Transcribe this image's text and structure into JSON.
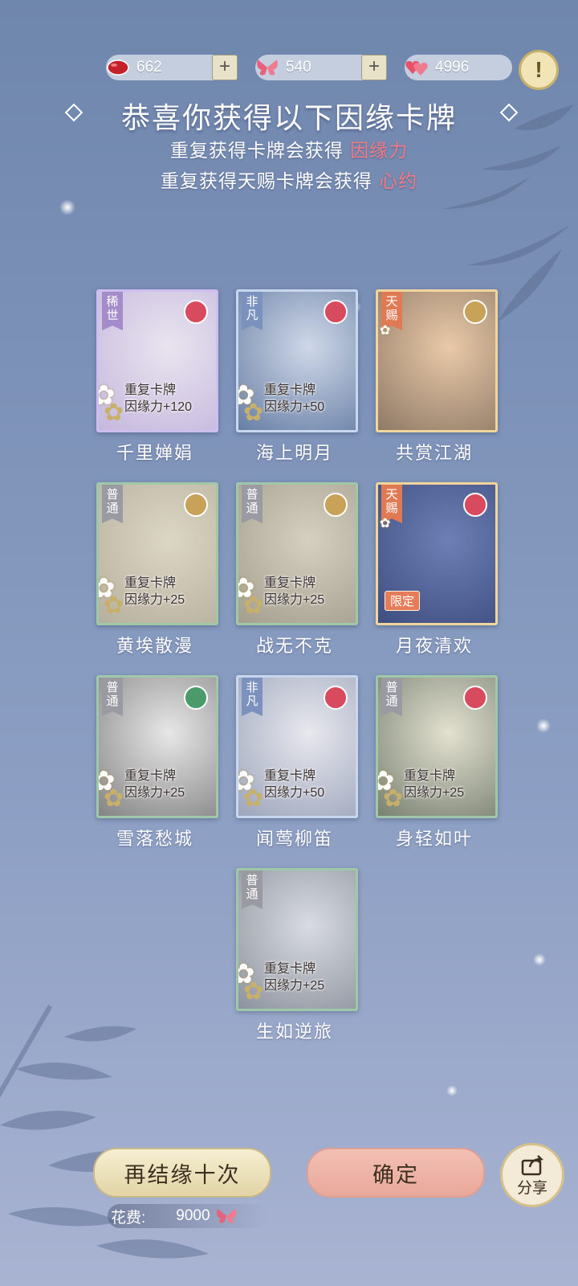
{
  "currencies": [
    {
      "icon": "red-bean-icon",
      "value": "662",
      "has_plus": true
    },
    {
      "icon": "butterfly-icon",
      "value": "540",
      "has_plus": true
    },
    {
      "icon": "hearts-icon",
      "value": "4996",
      "has_plus": false
    }
  ],
  "title": "恭喜你获得以下因缘卡牌",
  "subtitle_lines": [
    {
      "text": "重复获得卡牌会获得",
      "highlight": "因缘力"
    },
    {
      "text": "重复获得天赐卡牌会获得",
      "highlight": "心约"
    }
  ],
  "cards": [
    {
      "name": "千里婵娟",
      "rarity": "稀世",
      "repeat": "重复卡牌",
      "bonus": "因缘力+120",
      "seal": "flower"
    },
    {
      "name": "海上明月",
      "rarity": "非凡",
      "repeat": "重复卡牌",
      "bonus": "因缘力+50",
      "seal": "flower"
    },
    {
      "name": "共赏江湖",
      "rarity": "天赐",
      "repeat": "",
      "bonus": "",
      "seal": "gold"
    },
    {
      "name": "黄埃散漫",
      "rarity": "普通",
      "repeat": "重复卡牌",
      "bonus": "因缘力+25",
      "seal": "gold"
    },
    {
      "name": "战无不克",
      "rarity": "普通",
      "repeat": "重复卡牌",
      "bonus": "因缘力+25",
      "seal": "gold"
    },
    {
      "name": "月夜清欢",
      "rarity": "天赐",
      "repeat": "",
      "bonus": "",
      "seal": "flower",
      "limited": "限定"
    },
    {
      "name": "雪落愁城",
      "rarity": "普通",
      "repeat": "重复卡牌",
      "bonus": "因缘力+25",
      "seal": "green"
    },
    {
      "name": "闻莺柳笛",
      "rarity": "非凡",
      "repeat": "重复卡牌",
      "bonus": "因缘力+50",
      "seal": "flower"
    },
    {
      "name": "身轻如叶",
      "rarity": "普通",
      "repeat": "重复卡牌",
      "bonus": "因缘力+25",
      "seal": "flower"
    },
    {
      "name": "生如逆旅",
      "rarity": "普通",
      "repeat": "重复卡牌",
      "bonus": "因缘力+25",
      "seal": "none"
    }
  ],
  "buttons": {
    "again": "再结缘十次",
    "confirm": "确定",
    "share": "分享"
  },
  "cost": {
    "label": "花费:",
    "value": "9000"
  },
  "colors": {
    "rare": "#a48bc9",
    "fanfan": "#7a92bd",
    "tianci": "#e07a55",
    "common": "#9a9aa2",
    "highlight": "#f07a86"
  }
}
